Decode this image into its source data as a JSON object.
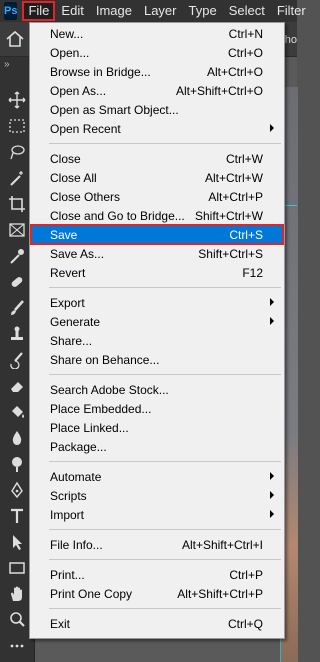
{
  "app": {
    "logo": "Ps"
  },
  "menubar": [
    "File",
    "Edit",
    "Image",
    "Layer",
    "Type",
    "Select",
    "Filter"
  ],
  "options_bar": {
    "home_icon": "home-icon",
    "shortcut_text": "Sho"
  },
  "toolbar": {
    "collapse": "»",
    "tools": [
      "move-icon",
      "marquee-icon",
      "lasso-icon",
      "magic-wand-icon",
      "crop-icon",
      "frame-icon",
      "eyedropper-icon",
      "healing-brush-icon",
      "brush-icon",
      "clone-stamp-icon",
      "history-brush-icon",
      "eraser-icon",
      "paint-bucket-icon",
      "blur-icon",
      "dodge-icon",
      "pen-icon",
      "type-icon",
      "path-selection-icon",
      "rectangle-icon",
      "hand-icon",
      "zoom-icon",
      "more-tools-icon"
    ]
  },
  "file_menu": {
    "groups": [
      [
        {
          "label": "New...",
          "shortcut": "Ctrl+N"
        },
        {
          "label": "Open...",
          "shortcut": "Ctrl+O"
        },
        {
          "label": "Browse in Bridge...",
          "shortcut": "Alt+Ctrl+O"
        },
        {
          "label": "Open As...",
          "shortcut": "Alt+Shift+Ctrl+O"
        },
        {
          "label": "Open as Smart Object...",
          "shortcut": ""
        },
        {
          "label": "Open Recent",
          "shortcut": "",
          "submenu": true
        }
      ],
      [
        {
          "label": "Close",
          "shortcut": "Ctrl+W"
        },
        {
          "label": "Close All",
          "shortcut": "Alt+Ctrl+W"
        },
        {
          "label": "Close Others",
          "shortcut": "Alt+Ctrl+P"
        },
        {
          "label": "Close and Go to Bridge...",
          "shortcut": "Shift+Ctrl+W"
        },
        {
          "label": "Save",
          "shortcut": "Ctrl+S",
          "highlighted": true
        },
        {
          "label": "Save As...",
          "shortcut": "Shift+Ctrl+S"
        },
        {
          "label": "Revert",
          "shortcut": "F12"
        }
      ],
      [
        {
          "label": "Export",
          "shortcut": "",
          "submenu": true
        },
        {
          "label": "Generate",
          "shortcut": "",
          "submenu": true
        },
        {
          "label": "Share...",
          "shortcut": ""
        },
        {
          "label": "Share on Behance...",
          "shortcut": ""
        }
      ],
      [
        {
          "label": "Search Adobe Stock...",
          "shortcut": ""
        },
        {
          "label": "Place Embedded...",
          "shortcut": ""
        },
        {
          "label": "Place Linked...",
          "shortcut": ""
        },
        {
          "label": "Package...",
          "shortcut": ""
        }
      ],
      [
        {
          "label": "Automate",
          "shortcut": "",
          "submenu": true
        },
        {
          "label": "Scripts",
          "shortcut": "",
          "submenu": true
        },
        {
          "label": "Import",
          "shortcut": "",
          "submenu": true
        }
      ],
      [
        {
          "label": "File Info...",
          "shortcut": "Alt+Shift+Ctrl+I"
        }
      ],
      [
        {
          "label": "Print...",
          "shortcut": "Ctrl+P"
        },
        {
          "label": "Print One Copy",
          "shortcut": "Alt+Shift+Ctrl+P"
        }
      ],
      [
        {
          "label": "Exit",
          "shortcut": "Ctrl+Q"
        }
      ]
    ]
  },
  "colors": {
    "highlight": "#0078d7",
    "focus_outline": "#e0252b",
    "menu_bg": "#f0f0f0",
    "chrome": "#323232"
  }
}
